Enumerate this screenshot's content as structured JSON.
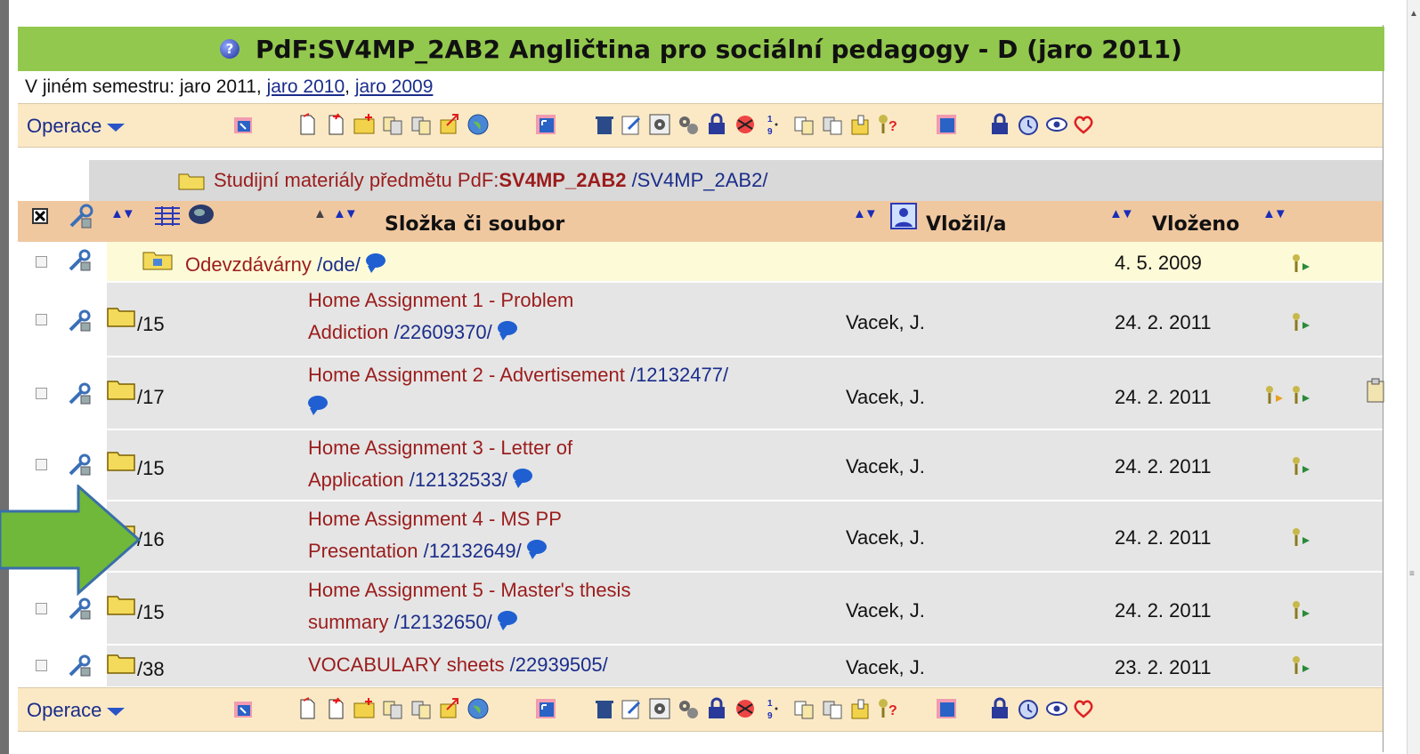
{
  "title": {
    "text": "PdF:SV4MP_2AB2 Angličtina pro sociální pedagogy - D (jaro 2011)",
    "help_icon": "?"
  },
  "semesters": {
    "prefix": "V jiném semestru: jaro 2011, ",
    "links": [
      "jaro 2010",
      "jaro 2009"
    ],
    "separator": ", "
  },
  "toolbar": {
    "operace_label": "Operace",
    "icons": [
      "upload-icon",
      "new-file-icon",
      "new-folder-icon",
      "copy-icon",
      "move-icon",
      "export-icon",
      "globe-icon",
      "select-icon",
      "trash-icon",
      "edit-icon",
      "settings-icon",
      "gears-icon",
      "lock-icon",
      "stamp-icon",
      "sort-icon",
      "copy2-icon",
      "paste-icon",
      "archive-icon",
      "key-help-icon",
      "select2-icon",
      "lock2-icon",
      "alarm-icon",
      "eye-icon",
      "heart-icon"
    ]
  },
  "breadcrumb": {
    "prefix": "Studijní materiály předmětu PdF:",
    "code": "SV4MP_2AB2",
    "path": " /SV4MP_2AB2/"
  },
  "header": {
    "col_name": "Složka či soubor",
    "col_author": "Vložil/a",
    "col_date": "Vloženo"
  },
  "rows": [
    {
      "count": "",
      "name": "Odevzdávárny",
      "id": "/ode/",
      "author": "",
      "date": "4. 5. 2009"
    },
    {
      "count": "/15",
      "name_l1": "Home Assignment 1 - Problem",
      "name_l2": "Addiction",
      "id": "/22609370/",
      "author": "Vacek, J.",
      "date": "24. 2. 2011"
    },
    {
      "count": "/17",
      "name_l1": "Home Assignment 2 - Advertisement",
      "id": "/12132477/",
      "author": "Vacek, J.",
      "date": "24. 2. 2011"
    },
    {
      "count": "/15",
      "name_l1": "Home Assignment 3 - Letter of",
      "name_l2": "Application",
      "id": "/12132533/",
      "author": "Vacek, J.",
      "date": "24. 2. 2011"
    },
    {
      "count": "/16",
      "name_l1": "Home Assignment 4 - MS PP",
      "name_l2": "Presentation",
      "id": "/12132649/",
      "author": "Vacek, J.",
      "date": "24. 2. 2011"
    },
    {
      "count": "/15",
      "name_l1": "Home Assignment 5 - Master's thesis",
      "name_l2": "summary",
      "id": "/12132650/",
      "author": "Vacek, J.",
      "date": "24. 2. 2011"
    },
    {
      "count": "/38",
      "name": "VOCABULARY sheets",
      "id": "/22939505/",
      "author": "Vacek, J.",
      "date": "23. 2. 2011"
    }
  ],
  "colors": {
    "title_bg": "#92c84e",
    "toolbar_bg": "#fbe9c6",
    "header_bg": "#f0c8a0",
    "row_bg": "#e5e5e5",
    "highlight_row_bg": "#fdfad8",
    "link_red": "#9b1c1c",
    "link_blue": "#1a2d8a",
    "arrow_green": "#6fb83a"
  }
}
